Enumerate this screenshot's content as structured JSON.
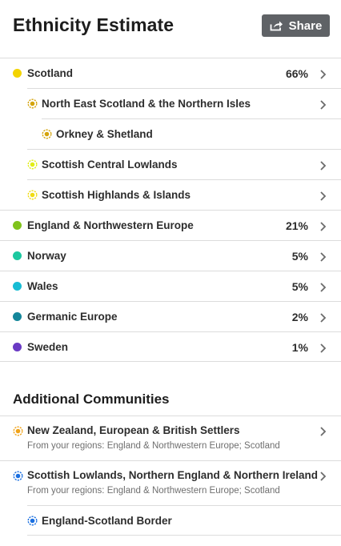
{
  "header": {
    "title": "Ethnicity Estimate",
    "share_label": "Share"
  },
  "regions": [
    {
      "name": "Scotland",
      "percent": "66%",
      "level": 0,
      "color": "#f3d400",
      "chevron": true
    },
    {
      "name": "North East Scotland & the Northern Isles",
      "percent": "",
      "level": 1,
      "color": "#d4a40c",
      "chevron": true
    },
    {
      "name": "Orkney & Shetland",
      "percent": "",
      "level": 2,
      "color": "#d4a40c",
      "chevron": false
    },
    {
      "name": "Scottish Central Lowlands",
      "percent": "",
      "level": 1,
      "color": "#e1ee14",
      "chevron": true
    },
    {
      "name": "Scottish Highlands & Islands",
      "percent": "",
      "level": 1,
      "color": "#f0dc14",
      "chevron": true
    },
    {
      "name": "England & Northwestern Europe",
      "percent": "21%",
      "level": 0,
      "color": "#80c31c",
      "chevron": true
    },
    {
      "name": "Norway",
      "percent": "5%",
      "level": 0,
      "color": "#1cc8a0",
      "chevron": true
    },
    {
      "name": "Wales",
      "percent": "5%",
      "level": 0,
      "color": "#17bcd4",
      "chevron": true
    },
    {
      "name": "Germanic Europe",
      "percent": "2%",
      "level": 0,
      "color": "#14869a",
      "chevron": true
    },
    {
      "name": "Sweden",
      "percent": "1%",
      "level": 0,
      "color": "#6a3ac4",
      "chevron": true
    }
  ],
  "communities_section": {
    "title": "Additional Communities",
    "items": [
      {
        "name": "New Zealand, European & British Settlers",
        "sub": "From your regions: England & Northwestern Europe; Scotland",
        "color": "#f0a31a"
      },
      {
        "name": "Scottish Lowlands, Northern England & Northern Ireland",
        "sub": "From your regions: England & Northwestern Europe; Scotland",
        "color": "#1a6fe0"
      }
    ],
    "sub_item": {
      "name": "England-Scotland Border",
      "color": "#1a6fe0"
    }
  },
  "icons": {
    "share": "share-arrow-icon",
    "chevron": "chevron-right-icon",
    "dot": "region-dot-icon",
    "ring": "subregion-ring-icon"
  }
}
